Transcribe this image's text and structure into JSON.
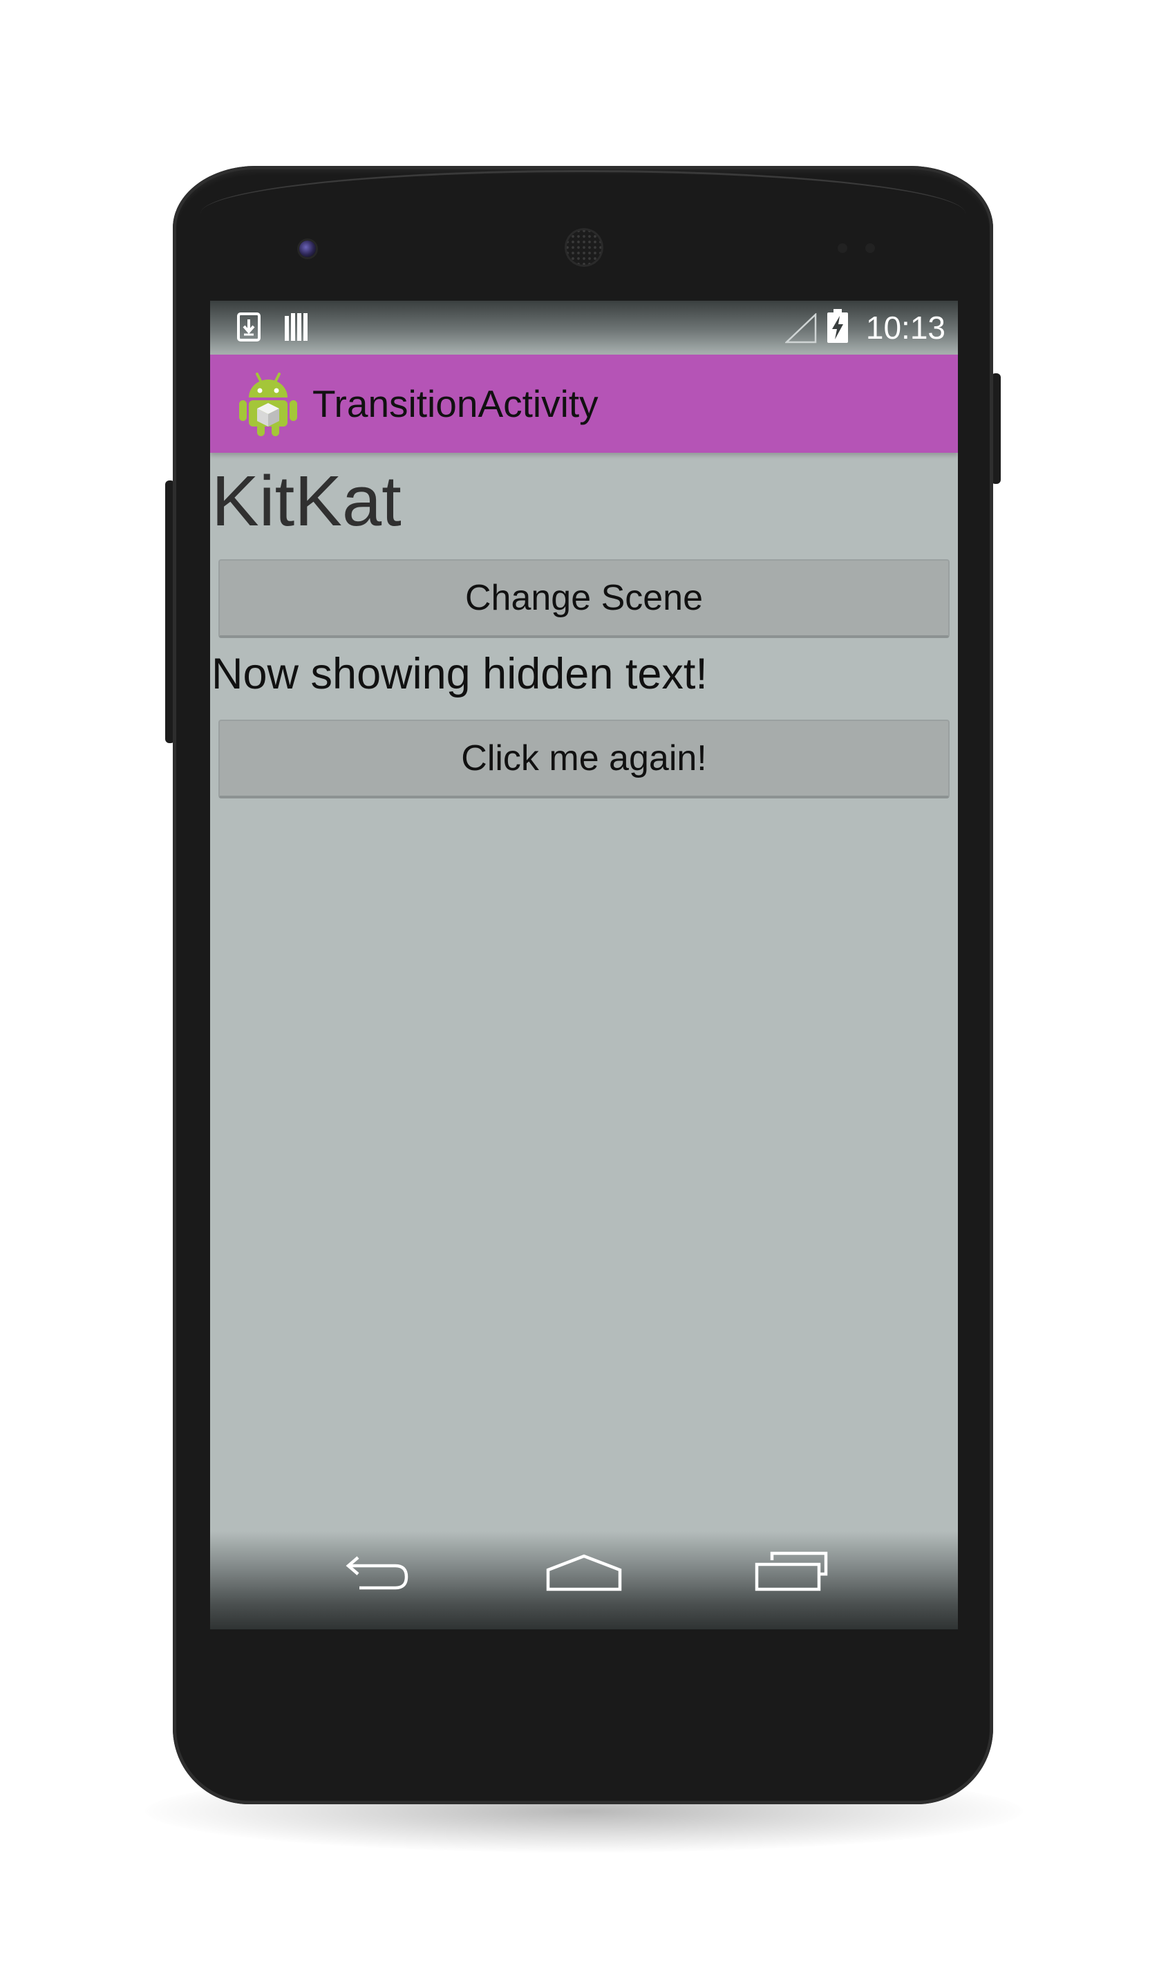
{
  "status_bar": {
    "clock": "10:13",
    "icons": [
      "download-icon",
      "storage-bars-icon",
      "signal-icon",
      "battery-charging-icon"
    ]
  },
  "action_bar": {
    "title": "TransitionActivity",
    "icon": "android-app-icon",
    "color": "#b554b6"
  },
  "content": {
    "heading": "KitKat",
    "change_scene_label": "Change Scene",
    "hidden_text": "Now showing hidden text!",
    "click_again_label": "Click me again!",
    "background_color": "#b4bcbb"
  },
  "nav_bar": {
    "icons": [
      "back-icon",
      "home-icon",
      "recents-icon"
    ]
  }
}
